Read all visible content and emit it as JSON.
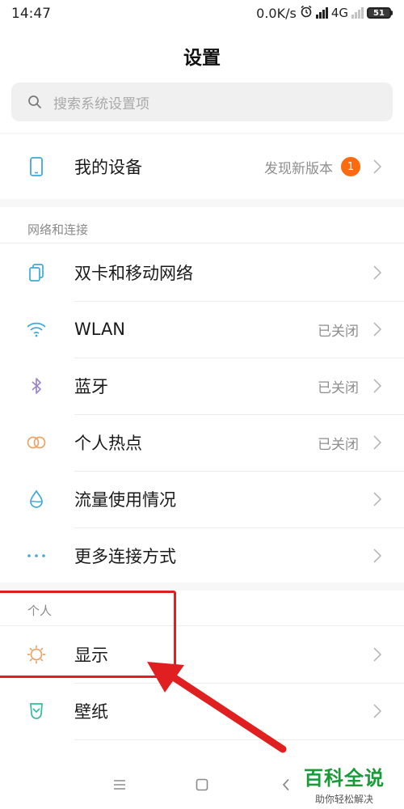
{
  "status_bar": {
    "time": "14:47",
    "network_speed": "0.0K/s",
    "network_type": "4G",
    "battery_level": "51",
    "icons": [
      "alarm-icon",
      "hd-signal-icon",
      "signal-icon",
      "battery-icon"
    ]
  },
  "header": {
    "title": "设置",
    "search": {
      "placeholder": "搜索系统设置项",
      "icon": "search-icon"
    }
  },
  "my_device": {
    "label": "我的设备",
    "value": "发现新版本",
    "badge": "1",
    "icon": "phone-icon"
  },
  "sections": {
    "network": {
      "label": "网络和连接",
      "items": [
        {
          "label": "双卡和移动网络",
          "value": "",
          "icon": "sim-card-icon"
        },
        {
          "label": "WLAN",
          "value": "已关闭",
          "icon": "wifi-icon"
        },
        {
          "label": "蓝牙",
          "value": "已关闭",
          "icon": "bluetooth-icon"
        },
        {
          "label": "个人热点",
          "value": "已关闭",
          "icon": "hotspot-icon"
        },
        {
          "label": "流量使用情况",
          "value": "",
          "icon": "data-usage-icon"
        },
        {
          "label": "更多连接方式",
          "value": "",
          "icon": "more-dots-icon"
        }
      ]
    },
    "personal": {
      "label": "个人",
      "items": [
        {
          "label": "显示",
          "value": "",
          "icon": "brightness-icon"
        },
        {
          "label": "壁纸",
          "value": "",
          "icon": "wallpaper-icon"
        }
      ]
    }
  },
  "nav_bar": {
    "icons": [
      "menu-icon",
      "home-icon",
      "back-icon"
    ]
  },
  "watermark": {
    "title": "百科全说",
    "subtitle": "助你轻松解决"
  },
  "colors": {
    "accent_blue": "#3fa9d8",
    "badge_orange": "#ff6a0e",
    "annotation_red": "#e02020",
    "watermark_green": "#1a9a38"
  }
}
